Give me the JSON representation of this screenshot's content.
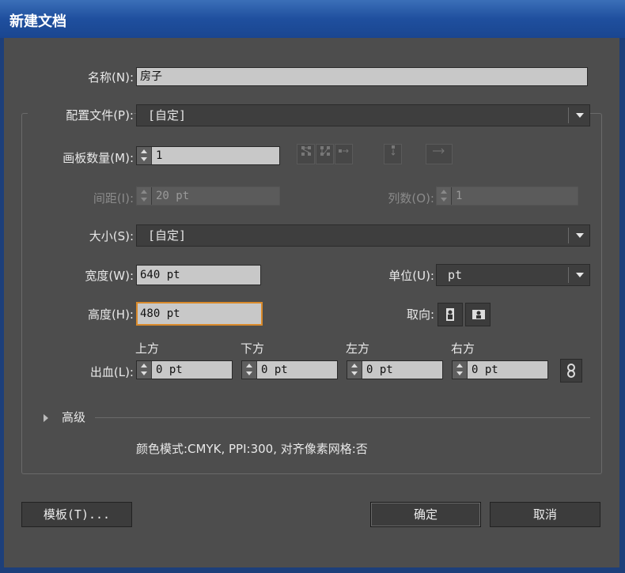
{
  "window": {
    "title": "新建文档"
  },
  "name": {
    "label": "名称(N):",
    "value": "房子"
  },
  "profile": {
    "label": "配置文件(P):",
    "value": "[自定]"
  },
  "artboards": {
    "label": "画板数量(M):",
    "value": "1"
  },
  "spacing": {
    "label": "间距(I):",
    "value": "20 pt"
  },
  "columns": {
    "label": "列数(O):",
    "value": "1"
  },
  "size": {
    "label": "大小(S):",
    "value": "[自定]"
  },
  "width": {
    "label": "宽度(W):",
    "value": "640 pt"
  },
  "units": {
    "label": "单位(U):",
    "value": "pt"
  },
  "height": {
    "label": "高度(H):",
    "value": "480 pt"
  },
  "orientation": {
    "label": "取向:",
    "options": [
      "portrait",
      "landscape"
    ]
  },
  "bleed": {
    "label": "出血(L):",
    "top_label": "上方",
    "top_value": "0 pt",
    "bottom_label": "下方",
    "bottom_value": "0 pt",
    "left_label": "左方",
    "left_value": "0 pt",
    "right_label": "右方",
    "right_value": "0 pt"
  },
  "advanced": {
    "label": "高级"
  },
  "summary": "颜色模式:CMYK, PPI:300, 对齐像素网格:否",
  "buttons": {
    "templates": "模板(T)...",
    "ok": "确定",
    "cancel": "取消"
  },
  "colors": {
    "focus_border": "#d98a2b",
    "dialog_bg": "#4d4d4d",
    "titlebar": "#1f4f9e"
  }
}
